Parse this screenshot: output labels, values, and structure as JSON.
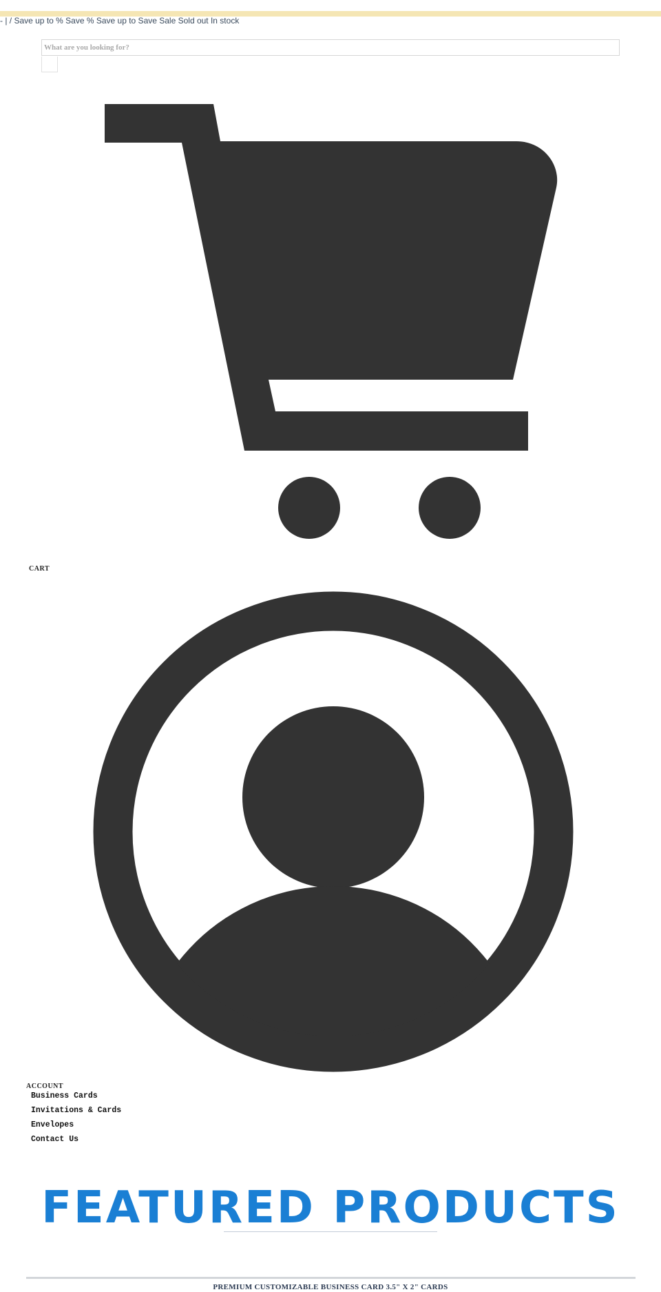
{
  "promo_text": "- | / Save up to % Save % Save up to Save Sale Sold out In stock",
  "search": {
    "placeholder": "What are you looking for?",
    "value": ""
  },
  "cart": {
    "label": "CART",
    "icon": "shopping-cart-icon"
  },
  "account": {
    "label": "ACCOUNT",
    "icon": "user-circle-icon"
  },
  "nav": {
    "items": [
      {
        "label": "Business Cards"
      },
      {
        "label": "Invitations & Cards"
      },
      {
        "label": "Envelopes"
      },
      {
        "label": "Contact Us"
      }
    ]
  },
  "featured": {
    "title": "FEATURED PRODUCTS"
  },
  "product": {
    "title": "PREMIUM CUSTOMIZABLE BUSINESS CARD 3.5\" X 2\" CARDS"
  },
  "colors": {
    "accent": "#1a7fd4",
    "icon": "#333333",
    "top_bar": "#f5e6b4"
  }
}
